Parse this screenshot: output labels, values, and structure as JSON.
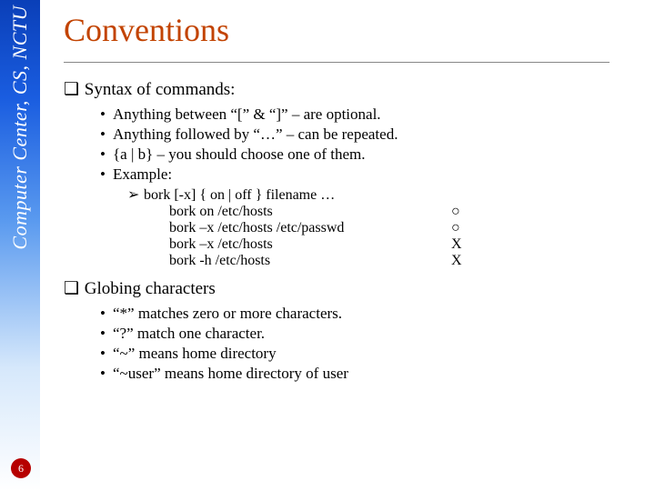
{
  "sidebar": {
    "label": "Computer Center, CS, NCTU"
  },
  "page_number": "6",
  "title": "Conventions",
  "sections": [
    {
      "heading": "Syntax of commands:",
      "bullets": [
        "Anything between “[” & “]” – are optional.",
        "Anything followed by “…” – can be repeated.",
        "{a | b} – you should choose one of them.",
        "Example:"
      ],
      "subline": "bork [-x] { on | off } filename …",
      "examples": [
        {
          "cmd": "bork on /etc/hosts",
          "mark": "○"
        },
        {
          "cmd": "bork –x /etc/hosts /etc/passwd",
          "mark": "○"
        },
        {
          "cmd": "bork –x /etc/hosts",
          "mark": "X"
        },
        {
          "cmd": "bork -h /etc/hosts",
          "mark": "X"
        }
      ]
    },
    {
      "heading": "Globing characters",
      "bullets": [
        "“*” matches zero or more characters.",
        "“?” match one character.",
        "“~” means home directory",
        "“~user” means home directory of user"
      ]
    }
  ],
  "glyphs": {
    "checkbox": "❑",
    "bullet": "•",
    "triangle": "➢"
  }
}
